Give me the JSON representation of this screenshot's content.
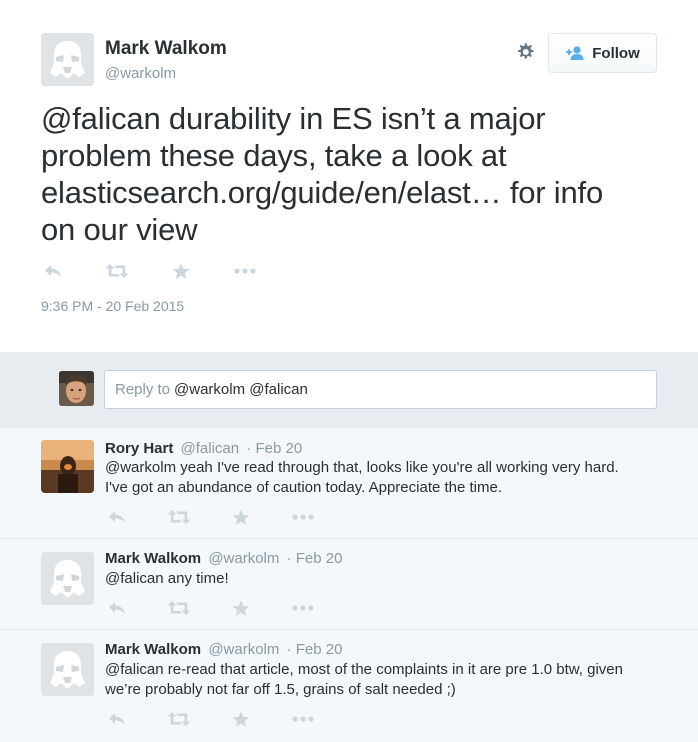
{
  "tweet": {
    "author_name": "Mark Walkom",
    "author_handle": "@warkolm",
    "follow_label": "Follow",
    "text_mention": "@falican",
    "text_part1": "durability in ES isn’t a major",
    "text_line2": "problem these days, take a look at",
    "text_url": "elasticsearch.org/guide/en/elast…",
    "text_part3": "for info",
    "text_line4": "on our view",
    "timestamp": "9:36 PM - 20 Feb 2015"
  },
  "reply_box": {
    "placeholder": "Reply to",
    "value": "@warkolm @falican"
  },
  "replies": [
    {
      "name": "Rory Hart",
      "handle": "@falican",
      "date": "· Feb 20",
      "mention": "@warkolm",
      "text_a": "yeah I've read through that, looks like you're all working very hard.",
      "text_b": "I've got an abundance of caution today. Appreciate the time."
    },
    {
      "name": "Mark Walkom",
      "handle": "@warkolm",
      "date": "· Feb 20",
      "mention": "@falican",
      "text_a": "any time!"
    },
    {
      "name": "Mark Walkom",
      "handle": "@warkolm",
      "date": "· Feb 20",
      "mention": "@falican",
      "text_a": "re-read that article, most of the complaints in it are pre 1.0 btw, given",
      "text_b": "we’re probably not far off 1.5, grains of salt needed ;)"
    }
  ],
  "icons": {
    "reply": "reply-icon",
    "retweet": "retweet-icon",
    "favorite": "star-icon",
    "more": "more-icon",
    "settings": "gear-icon",
    "follow": "add-user-icon"
  },
  "colors": {
    "text": "#292f33",
    "muted": "#8899a6",
    "icon": "#ccd6dd",
    "follow_icon": "#55acee",
    "reply_bar_bg": "#e6ecf0",
    "replies_bg": "#f5f8fa"
  }
}
